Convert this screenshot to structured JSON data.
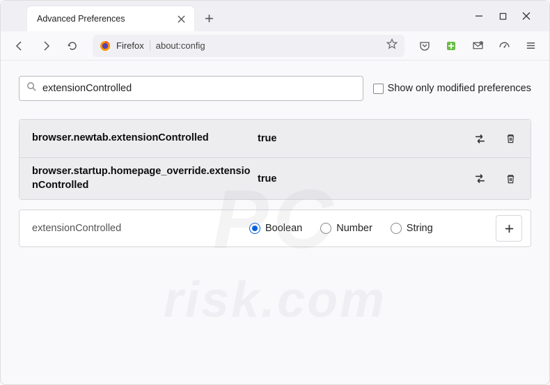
{
  "window": {
    "tab_title": "Advanced Preferences"
  },
  "toolbar": {
    "url_label": "Firefox",
    "url": "about:config"
  },
  "search": {
    "value": "extensionControlled",
    "show_modified_label": "Show only modified preferences"
  },
  "prefs": [
    {
      "name": "browser.newtab.extensionControlled",
      "value": "true"
    },
    {
      "name": "browser.startup.homepage_override.extensionControlled",
      "value": "true"
    }
  ],
  "add": {
    "name": "extensionControlled",
    "types": {
      "boolean": "Boolean",
      "number": "Number",
      "string": "String"
    },
    "selected": "boolean"
  },
  "watermark": {
    "top": "PC",
    "bottom": "risk.com"
  }
}
